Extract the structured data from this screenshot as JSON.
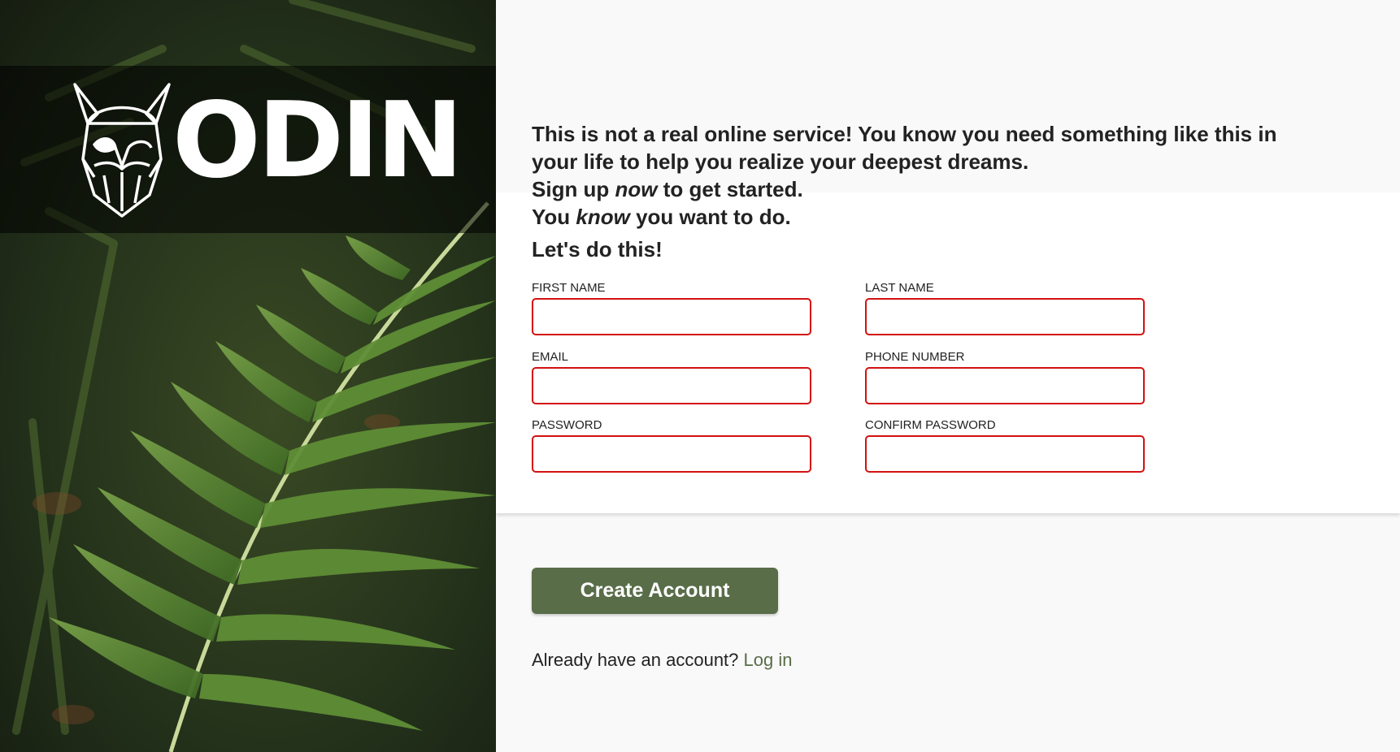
{
  "brand": {
    "name": "ODIN"
  },
  "intro": {
    "line1": "This is not a real online service! You know you need something like this in your life to help you realize your deepest dreams.",
    "signup_prefix": "Sign up ",
    "signup_em": "now",
    "signup_suffix": " to get started.",
    "know_prefix": "You ",
    "know_em": "know",
    "know_suffix": " you want to do."
  },
  "form": {
    "title": "Let's do this!",
    "fields": [
      {
        "label": "FIRST NAME",
        "value": ""
      },
      {
        "label": "LAST NAME",
        "value": ""
      },
      {
        "label": "EMAIL",
        "value": ""
      },
      {
        "label": "PHONE NUMBER",
        "value": ""
      },
      {
        "label": "PASSWORD",
        "value": ""
      },
      {
        "label": "CONFIRM PASSWORD",
        "value": ""
      }
    ],
    "submit_label": "Create Account"
  },
  "login": {
    "prompt": "Already have an account? ",
    "link_label": "Log in"
  },
  "colors": {
    "accent": "#596d48",
    "invalid_border": "#d31111"
  }
}
